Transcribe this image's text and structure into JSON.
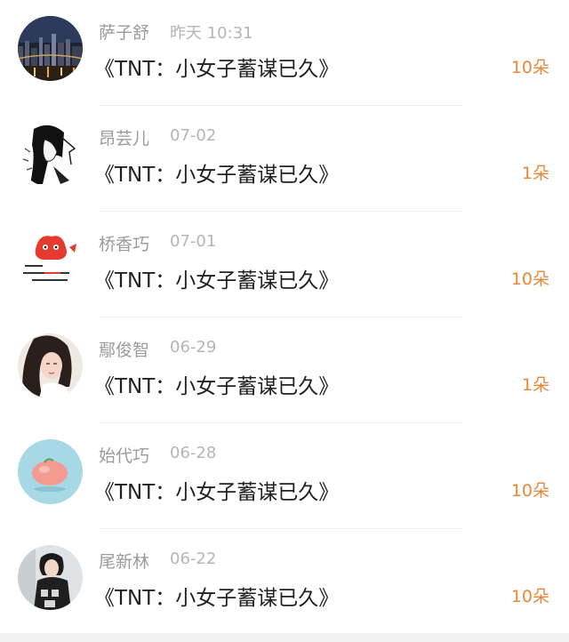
{
  "gifts": [
    {
      "user": "萨子舒",
      "time": "昨天 10:31",
      "title": "《TNT：小女子蓄谋已久》",
      "count": "10朵",
      "avatar": "city-night-avatar-icon"
    },
    {
      "user": "昂芸儿",
      "time": "07-02",
      "title": "《TNT：小女子蓄谋已久》",
      "count": "1朵",
      "avatar": "manga-girl-avatar-icon"
    },
    {
      "user": "桥香巧",
      "time": "07-01",
      "title": "《TNT：小女子蓄谋已久》",
      "count": "10朵",
      "avatar": "red-cartoon-avatar-icon"
    },
    {
      "user": "鄢俊智",
      "time": "06-29",
      "title": "《TNT：小女子蓄谋已久》",
      "count": "1朵",
      "avatar": "woman-portrait-avatar-icon"
    },
    {
      "user": "始代巧",
      "time": "06-28",
      "title": "《TNT：小女子蓄谋已久》",
      "count": "10朵",
      "avatar": "peach-blob-avatar-icon"
    },
    {
      "user": "尾新林",
      "time": "06-22",
      "title": "《TNT：小女子蓄谋已久》",
      "count": "10朵",
      "avatar": "girl-photo-avatar-icon"
    }
  ],
  "theme": {
    "accent": "#e8883a",
    "name_color": "#9a9a9a",
    "title_color": "#222222"
  }
}
